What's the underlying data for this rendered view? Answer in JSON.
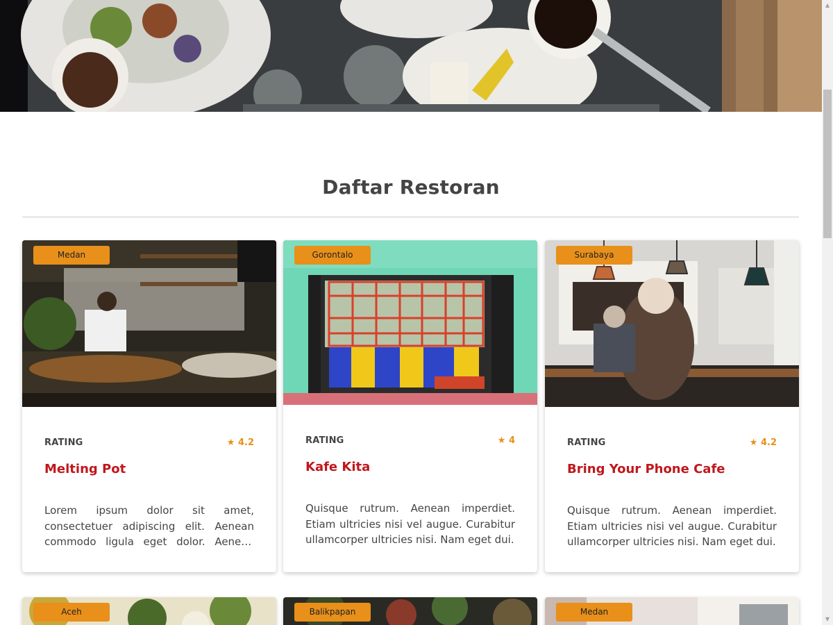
{
  "section": {
    "title": "Daftar Restoran"
  },
  "restaurants": [
    {
      "city": "Medan",
      "rating_label": "RATING",
      "rating": "★ 4.2",
      "name": "Melting Pot",
      "description": "Lorem ipsum dolor sit amet, consectetuer adipiscing elit. Aenean commodo ligula eget dolor. Aenean massa."
    },
    {
      "city": "Gorontalo",
      "rating_label": "RATING",
      "rating": "★ 4",
      "name": "Kafe Kita",
      "description": "Quisque rutrum. Aenean imperdiet. Etiam ultricies nisi vel augue. Curabitur ullamcorper ultricies nisi. Nam eget dui."
    },
    {
      "city": "Surabaya",
      "rating_label": "RATING",
      "rating": "★ 4.2",
      "name": "Bring Your Phone Cafe",
      "description": "Quisque rutrum. Aenean imperdiet. Etiam ultricies nisi vel augue. Curabitur ullamcorper ultricies nisi. Nam eget dui."
    },
    {
      "city": "Aceh"
    },
    {
      "city": "Balikpapan"
    },
    {
      "city": "Medan"
    }
  ],
  "colors": {
    "accent": "#e8901a",
    "name": "#c0171c"
  },
  "icons": {
    "star": "star-icon"
  }
}
